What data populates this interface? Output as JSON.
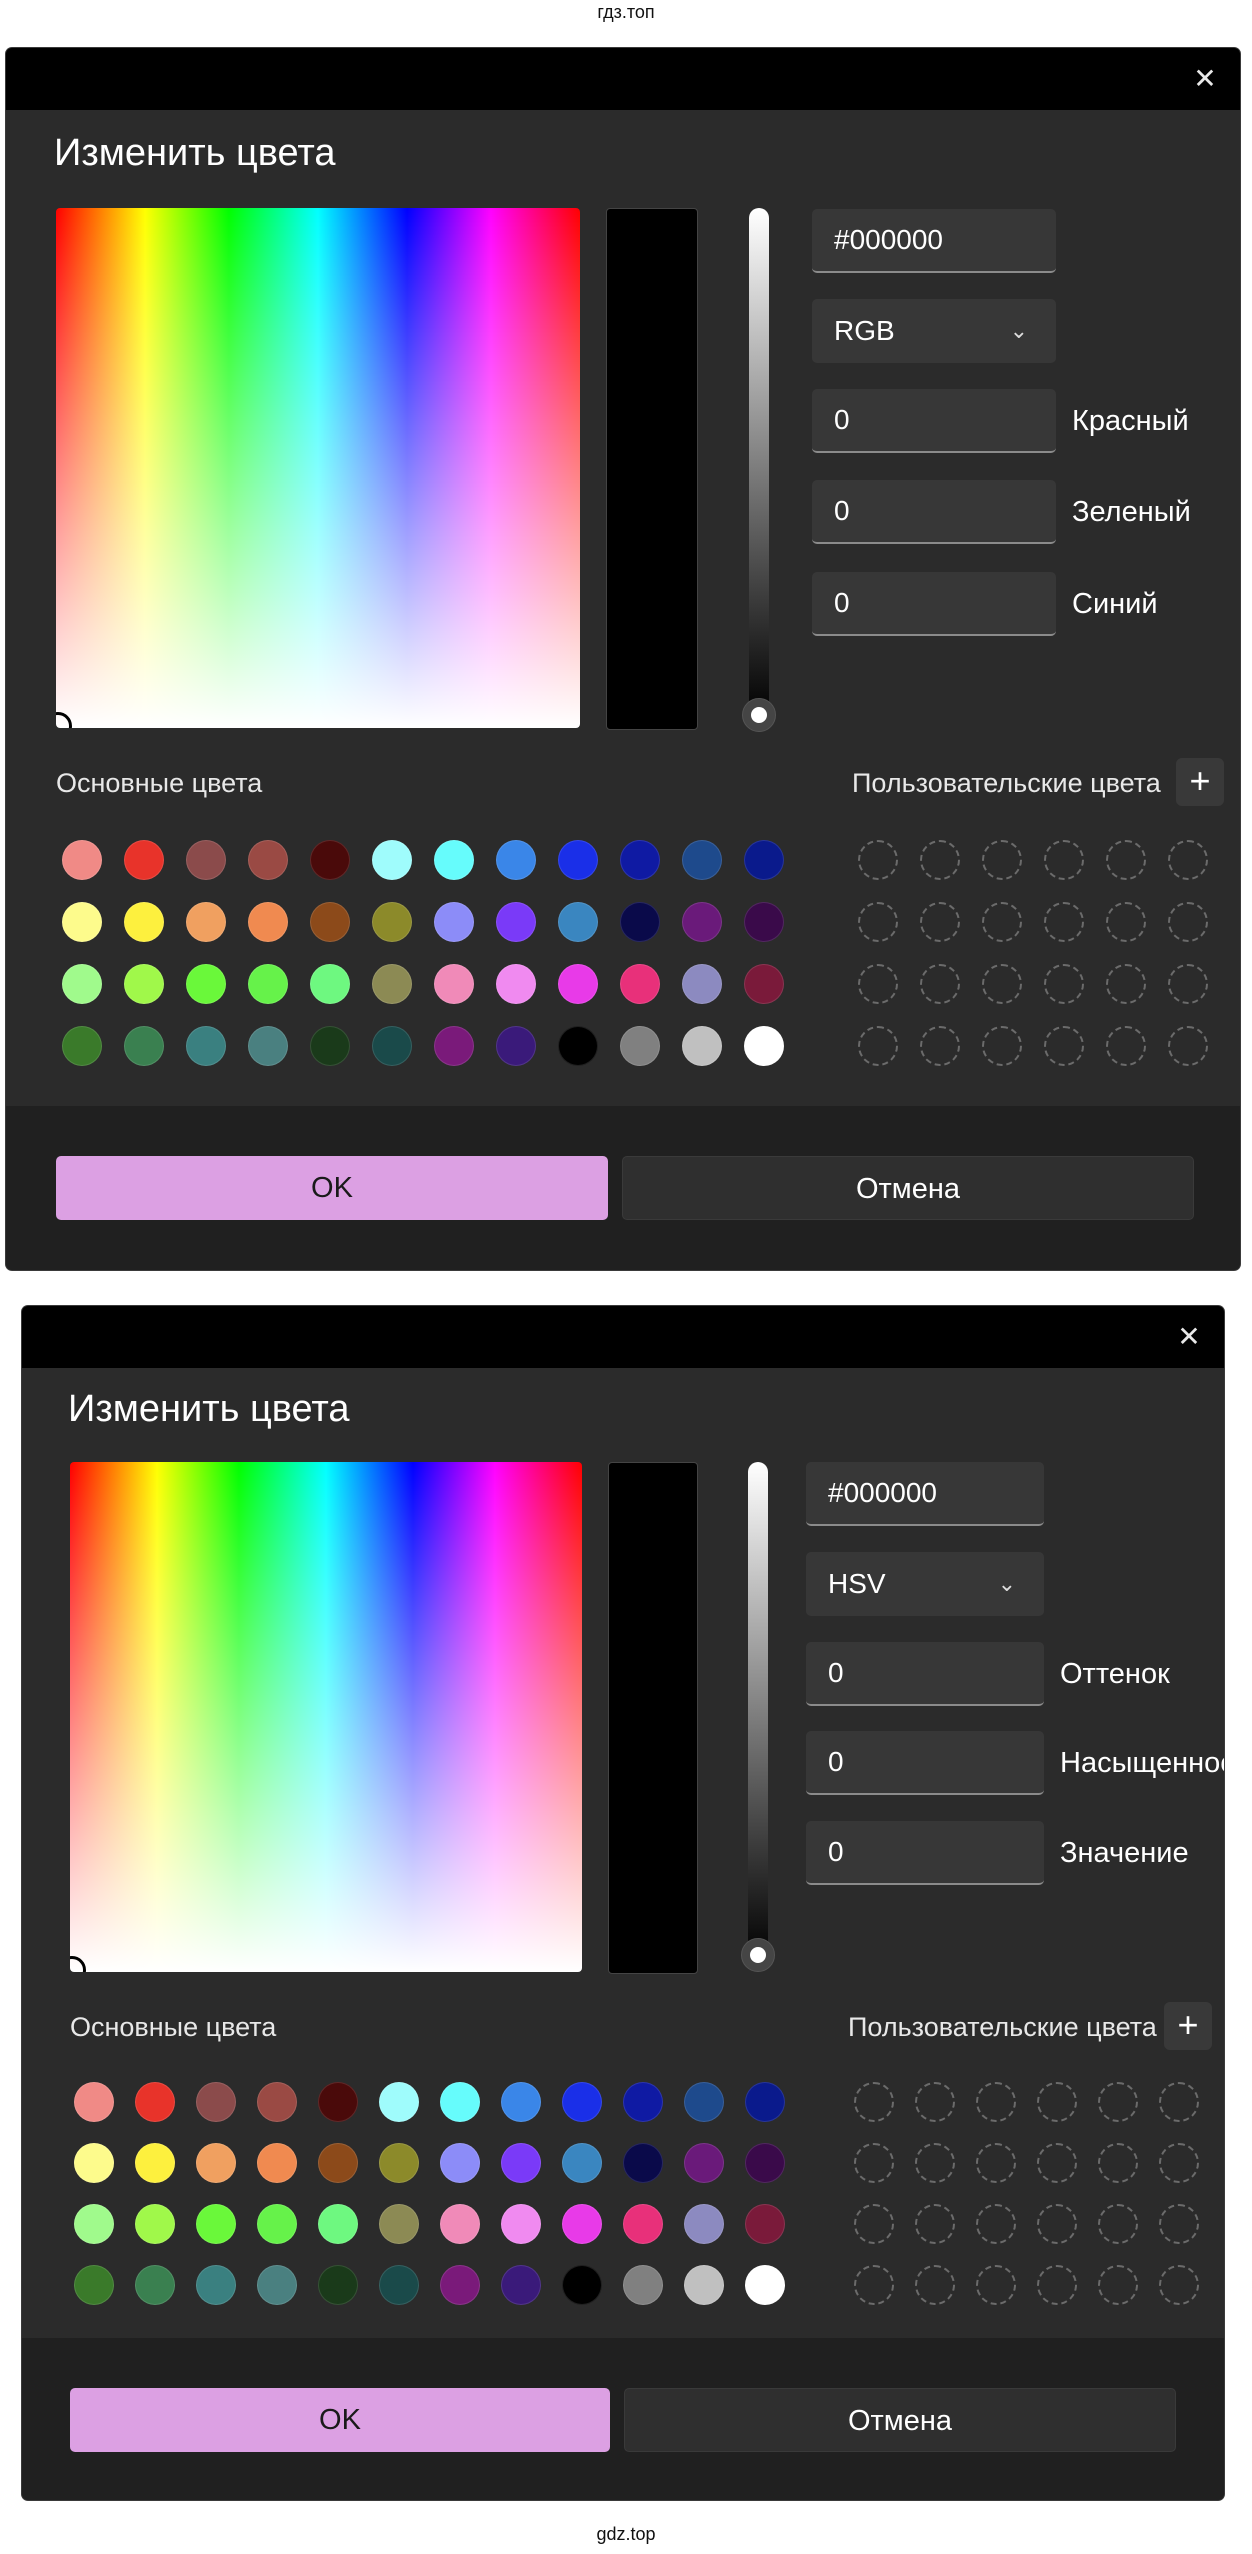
{
  "watermark_top": "гдз.топ",
  "watermark_bottom": "gdz.top",
  "close_glyph": "✕",
  "plus_glyph": "+",
  "chevron_glyph": "⌄",
  "basic_colors": [
    "#f08a86",
    "#e8332a",
    "#8b4b4b",
    "#9a4a44",
    "#4a0a0a",
    "#9ffcfc",
    "#66fcfc",
    "#3a86e8",
    "#1a2fe8",
    "#0f1aa3",
    "#1e4a8c",
    "#0a1a8c",
    "#fdfb8c",
    "#fdf03e",
    "#f0a060",
    "#f08a50",
    "#8c4a1a",
    "#8c8a2a",
    "#8c8cf8",
    "#7a3af8",
    "#3a86c0",
    "#0a0a4a",
    "#6a1a7a",
    "#3a0a4a",
    "#a0fa8c",
    "#a0f84a",
    "#6af83a",
    "#66f24a",
    "#6ef880",
    "#8c8a54",
    "#f08ab8",
    "#f08af0",
    "#e83ae8",
    "#e8307a",
    "#8c8ac0",
    "#7a1a3a",
    "#3a7a2a",
    "#3a8050",
    "#3a8080",
    "#4a8080",
    "#1a3a1a",
    "#1a4a4a",
    "#7a1a7a",
    "#3a1a7a",
    "#000000",
    "#808080",
    "#c0c0c0",
    "#ffffff"
  ],
  "dialogs": [
    {
      "title": "Изменить цвета",
      "hex_value": "#000000",
      "mode_value": "RGB",
      "channels": [
        {
          "value": "0",
          "label": "Красный"
        },
        {
          "value": "0",
          "label": "Зеленый"
        },
        {
          "value": "0",
          "label": "Синий"
        }
      ],
      "basic_colors_label": "Основные цвета",
      "custom_colors_label": "Пользовательские цвета",
      "ok_label": "OK",
      "cancel_label": "Отмена"
    },
    {
      "title": "Изменить цвета",
      "hex_value": "#000000",
      "mode_value": "HSV",
      "channels": [
        {
          "value": "0",
          "label": "Оттенок"
        },
        {
          "value": "0",
          "label": "Насыщенность"
        },
        {
          "value": "0",
          "label": "Значение"
        }
      ],
      "basic_colors_label": "Основные цвета",
      "custom_colors_label": "Пользовательские цвета",
      "ok_label": "OK",
      "cancel_label": "Отмена"
    }
  ]
}
